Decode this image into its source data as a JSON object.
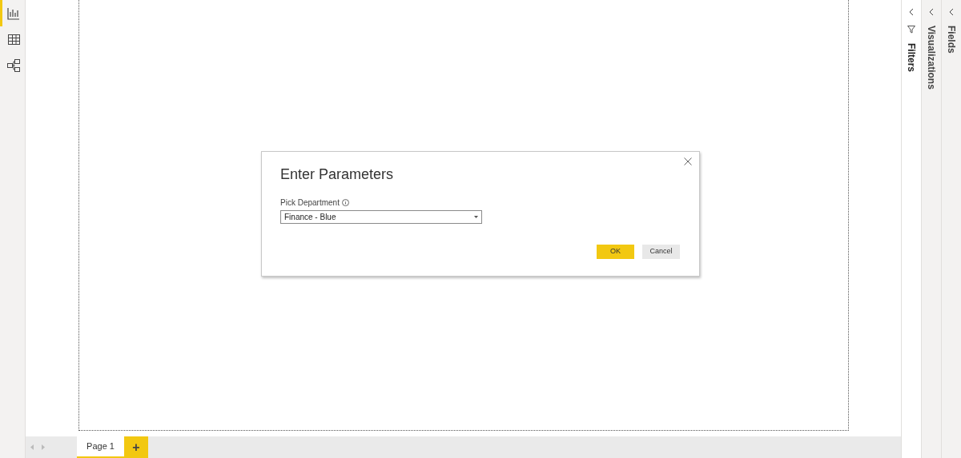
{
  "nav": [
    {
      "kind": "report",
      "selected": true
    },
    {
      "kind": "data",
      "selected": false
    },
    {
      "kind": "model",
      "selected": false
    }
  ],
  "pages": [
    {
      "label": "Page 1",
      "selected": true
    }
  ],
  "add_page": "+",
  "panes": [
    {
      "kind": "filters",
      "title": "Filters"
    },
    {
      "kind": "visualizations",
      "title": "Visualizations"
    },
    {
      "kind": "fields",
      "title": "Fields"
    }
  ],
  "dialog": {
    "title": "Enter Parameters",
    "field_label": "Pick Department",
    "field_value": "Finance - Blue",
    "buttons": [
      {
        "label": "OK",
        "kind": "primary"
      },
      {
        "label": "Cancel",
        "kind": "secondary"
      }
    ]
  }
}
